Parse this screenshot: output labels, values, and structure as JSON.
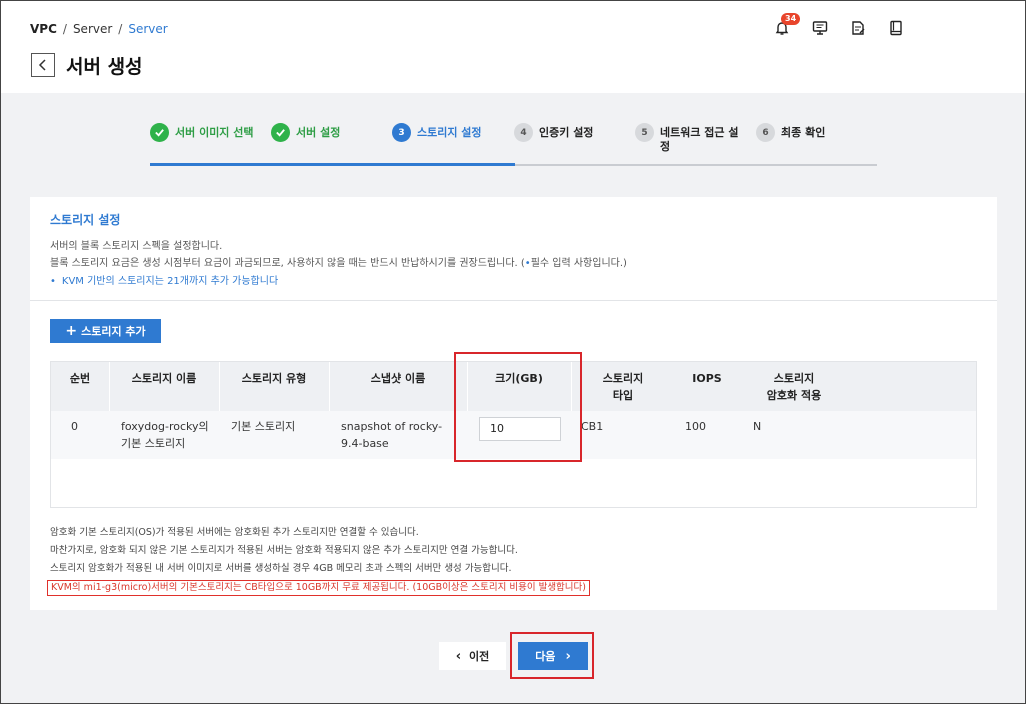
{
  "breadcrumb": {
    "root": "VPC",
    "sep": "/",
    "mid": "Server",
    "current": "Server"
  },
  "page_title": "서버 생성",
  "notification_count": "34",
  "icons": {
    "back": "chevron-left-icon",
    "bell": "bell-icon",
    "monitor": "chat-monitor-icon",
    "edit": "edit-note-icon",
    "book": "book-icon"
  },
  "steps": [
    {
      "num": "1",
      "label": "서버 이미지 선택",
      "state": "done"
    },
    {
      "num": "2",
      "label": "서버 설정",
      "state": "done"
    },
    {
      "num": "3",
      "label": "스토리지 설정",
      "state": "active"
    },
    {
      "num": "4",
      "label": "인증키 설정",
      "state": "todo"
    },
    {
      "num": "5",
      "label": "네트워크 접근 설",
      "label2": "정",
      "state": "todo"
    },
    {
      "num": "6",
      "label": "최종 확인",
      "state": "todo"
    }
  ],
  "section": {
    "title": "스토리지 설정",
    "desc1": "서버의 블록 스토리지 스펙을 설정합니다.",
    "desc2_pre": "블록 스토리지 요금은 생성 시점부터 요금이 과금되므로, 사용하지 않을 때는 반드시 반납하시기를 권장드립니다. (",
    "desc2_dot": "•",
    "desc2_post": "필수 입력 사항입니다.)",
    "note": "KVM 기반의 스토리지는 21개까지 추가 가능합니다",
    "add_button": "스토리지 추가"
  },
  "table": {
    "headers": [
      "순번",
      "스토리지 이름",
      "스토리지 유형",
      "스냅샷 이름",
      "크기(GB)",
      "스토리지",
      "타입",
      "IOPS",
      "스토리지",
      "암호화 적용"
    ],
    "row": {
      "index": "0",
      "name_line1": "foxydog-rocky의",
      "name_line2": "기본 스토리지",
      "type": "기본 스토리지",
      "snapshot_line1": "snapshot of rocky-",
      "snapshot_line2": "9.4-base",
      "size": "10",
      "storage_type": "CB1",
      "iops": "100",
      "encryption": "N"
    }
  },
  "notes": [
    "암호화 기본 스토리지(OS)가 적용된 서버에는 암호화된 추가 스토리지만 연결할 수 있습니다.",
    "마찬가지로, 암호화 되지 않은 기본 스토리지가 적용된 서버는 암호화 적용되지 않은 추가 스토리지만 연결 가능합니다.",
    "스토리지 암호화가 적용된 내 서버 이미지로 서버를 생성하실 경우 4GB 메모리 초과 스펙의 서버만 생성 가능합니다.",
    "KVM의 mi1-g3(micro)서버의 기본스토리지는 CB타입으로 10GB까지 무료 제공됩니다. (10GB이상은 스토리지 비용이 발생합니다)"
  ],
  "buttons": {
    "prev": "이전",
    "next": "다음"
  },
  "colors": {
    "accent": "#2f7ad1",
    "done": "#2fb24a",
    "highlight": "#d8262b",
    "badge": "#e8452c"
  }
}
